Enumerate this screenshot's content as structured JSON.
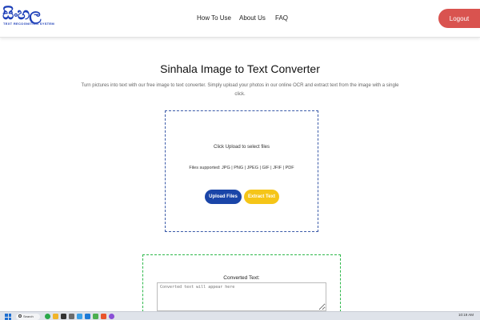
{
  "header": {
    "logo_main": "සිංහල",
    "logo_sub": "TEXT RECOGNITION SYSTEM",
    "nav": [
      "How To Use",
      "About Us",
      "FAQ"
    ],
    "logout_label": "Logout"
  },
  "main": {
    "title": "Sinhala Image to Text Converter",
    "subtitle": "Turn pictures into text with our free image to text converter. Simply upload your photos in our online OCR and extract text from the image with a single click."
  },
  "upload": {
    "hint": "Click Upload to select files",
    "supported": "Files supported: JPG | PNG | JPEG | GIF | JFIF | PDF",
    "upload_button": "Upload Files",
    "extract_button": "Extract Text"
  },
  "converted": {
    "label": "Converted Text:",
    "placeholder": "Converted text will appear here"
  },
  "taskbar": {
    "search_label": "Search",
    "time": "10:19 AM"
  },
  "colors": {
    "brand_blue": "#1d3fb8",
    "logout_red": "#d9534f",
    "upload_blue": "#1a45a8",
    "extract_yellow": "#f5c518",
    "converted_green": "#2db84a"
  }
}
